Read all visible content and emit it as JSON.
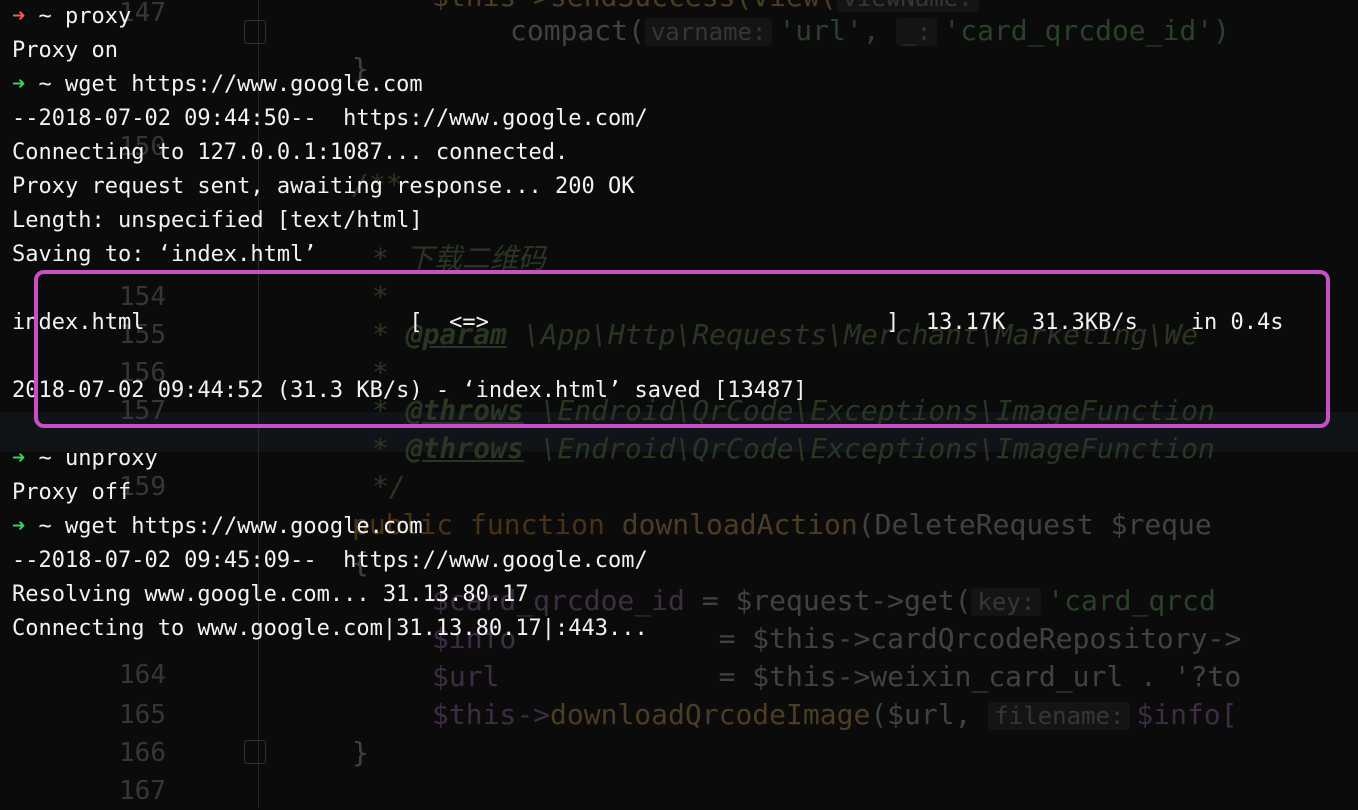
{
  "editor": {
    "line_numbers": [
      "147",
      "",
      "",
      "150",
      "",
      "",
      "",
      "",
      "154",
      "155",
      "156",
      "157",
      "",
      "159",
      "",
      "",
      "",
      "",
      "164",
      "165",
      "166",
      "167"
    ],
    "code": {
      "l1_fn": "$this->sendSuccess(view(",
      "l1_hint": "viewName:",
      "l2_fn": "compact(",
      "l2_hint": "varname:",
      "l2_str1": "'url',",
      "l2_hint2": "_:",
      "l2_str2": "'card_qrcdoe_id')",
      "l3": "}",
      "l4": "/**",
      "l5": "* 下载二维码",
      "l6": "*",
      "l7_tag": "@param",
      "l7_rest": "\\App\\Http\\Requests\\Merchant\\Marketing\\We",
      "l8": "*",
      "l9_tag": "@throws",
      "l9_rest": "\\Endroid\\QrCode\\Exceptions\\ImageFunction",
      "l10_tag": "@throws",
      "l10_rest": "\\Endroid\\QrCode\\Exceptions\\ImageFunction",
      "l11": "*/",
      "l12_kw": "public function",
      "l12_fn": "downloadAction",
      "l12_rest": "(DeleteRequest $reque",
      "l13": "{",
      "l14_var": "$card_qrcdoe_id",
      "l14_mid": "= $request->get(",
      "l14_hint": "key:",
      "l14_str": "'card_qrcd",
      "l15_var": "$info",
      "l15_mid": "= $this->cardQrcodeRepository->",
      "l16_var": "$url",
      "l16_mid": "= $this->weixin_card_url . '?to",
      "l17_var": "$this->",
      "l17_fn": "downloadQrcodeImage",
      "l17_mid": "($url,",
      "l17_hint": "filename:",
      "l17_end": "$info[",
      "l18": "}"
    }
  },
  "terminal": {
    "prompt_arrow": "➜",
    "prompt_dir": "~",
    "lines": {
      "cmd_proxy": "proxy",
      "proxy_on": "Proxy on",
      "cmd_wget1": "wget https://www.google.com",
      "ts1": "--2018-07-02 09:44:50--  https://www.google.com/",
      "connecting1": "Connecting to 127.0.0.1:1087... connected.",
      "proxy_request": "Proxy request sent, awaiting response... 200 OK",
      "length": "Length: unspecified [text/html]",
      "saving": "Saving to: ‘index.html’",
      "progress": "index.html                    [  <=>                              ]  13.17K  31.3KB/s    in 0.4s",
      "saved": "2018-07-02 09:44:52 (31.3 KB/s) - ‘index.html’ saved [13487]",
      "cmd_unproxy": "unproxy",
      "proxy_off": "Proxy off",
      "cmd_wget2": "wget https://www.google.com",
      "ts2": "--2018-07-02 09:45:09--  https://www.google.com/",
      "resolving": "Resolving www.google.com... 31.13.80.17",
      "connecting2": "Connecting to www.google.com|31.13.80.17|:443..."
    }
  },
  "colors": {
    "highlight_box": "#c94fc9",
    "arrow_error": "#ff5555",
    "arrow_ok": "#39d353"
  }
}
